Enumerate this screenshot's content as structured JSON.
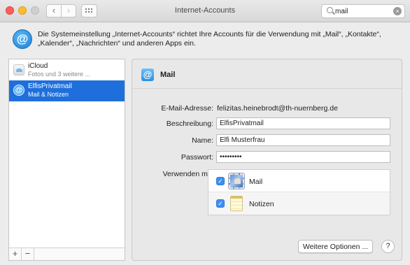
{
  "window": {
    "title": "Internet-Accounts",
    "nav_back": "‹",
    "nav_forward": "›"
  },
  "search": {
    "value": "mail",
    "clear_icon": "×"
  },
  "header": {
    "icon_glyph": "@",
    "description": "Die Systemeinstellung „Internet-Accounts“ richtet Ihre Accounts für die Verwendung mit „Mail“, „Kontakte“, „Kalender“, „Nachrichten“ und anderen Apps ein."
  },
  "sidebar": {
    "accounts": [
      {
        "name": "iCloud",
        "subtitle": "Fotos und 3 weitere ...",
        "icon": "cloud-icon",
        "selected": false
      },
      {
        "name": "ElfisPrivatmail",
        "subtitle": "Mail & Notizen",
        "icon": "at-icon",
        "selected": true
      }
    ],
    "add_label": "+",
    "remove_label": "−"
  },
  "detail": {
    "title": "Mail",
    "icon_glyph": "@",
    "email_label": "E-Mail-Adresse:",
    "email_value": "felizitas.heinebrodt@th-nuernberg.de",
    "description_label": "Beschreibung:",
    "description_value": "ElfisPrivatmail",
    "name_label": "Name:",
    "name_value": "Elfi Musterfrau",
    "password_label": "Passwort:",
    "password_value": "•••••••••",
    "use_with_label": "Verwenden mit:",
    "apps": [
      {
        "label": "Mail",
        "checked": true,
        "icon": "mail-stamp-icon"
      },
      {
        "label": "Notizen",
        "checked": true,
        "icon": "notes-icon"
      }
    ],
    "check_glyph": "✓",
    "more_options_label": "Weitere Optionen ...",
    "help_label": "?"
  },
  "colors": {
    "selection": "#1e6fdc",
    "checkbox": "#3d8ff0"
  }
}
